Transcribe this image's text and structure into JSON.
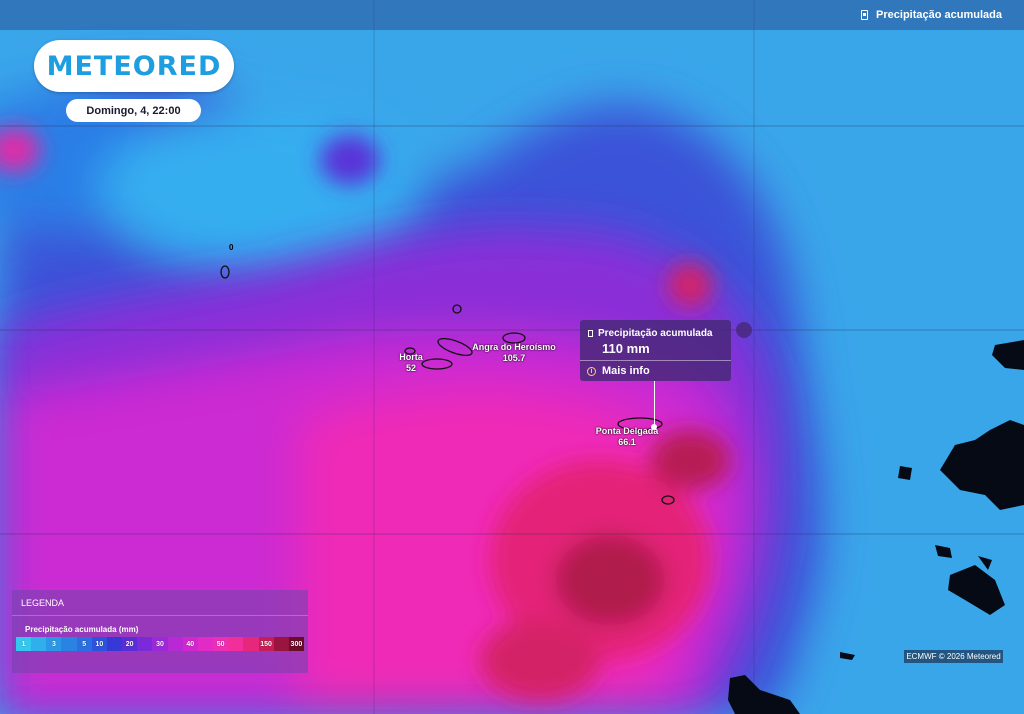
{
  "header": {
    "layer_title": "Precipitação acumulada",
    "layer_icon": "rain-gauge-icon"
  },
  "brand": {
    "logo_text": "METEORED",
    "logo_color": "#1d9ee0"
  },
  "timestamp": "Domingo, 4, 22:00",
  "map": {
    "stray_label": "0",
    "cities": [
      {
        "name": "Horta",
        "value": "52"
      },
      {
        "name": "Angra do Heroísmo",
        "value": "105.7"
      },
      {
        "name": "Ponta Delgada",
        "value": "66.1"
      }
    ]
  },
  "popup": {
    "title": "Precipitação acumulada",
    "value": "110 mm",
    "more_label": "Mais info",
    "icon": "info-icon"
  },
  "legend": {
    "title": "LEGENDA",
    "variable": "Precipitação acumulada (mm)",
    "steps": [
      {
        "label": "1",
        "color": "#32c8f0"
      },
      {
        "label": "",
        "color": "#2fb0ec"
      },
      {
        "label": "3",
        "color": "#2a98e6"
      },
      {
        "label": "",
        "color": "#2a82e2"
      },
      {
        "label": "5",
        "color": "#2a6ee0"
      },
      {
        "label": "10",
        "color": "#2d52dc"
      },
      {
        "label": "",
        "color": "#3838d6"
      },
      {
        "label": "20",
        "color": "#5a2ed6"
      },
      {
        "label": "",
        "color": "#7a2ad8"
      },
      {
        "label": "30",
        "color": "#9a2ad8"
      },
      {
        "label": "",
        "color": "#b828d4"
      },
      {
        "label": "40",
        "color": "#d226cf"
      },
      {
        "label": "",
        "color": "#e22ac6"
      },
      {
        "label": "50",
        "color": "#ee2eb6"
      },
      {
        "label": "",
        "color": "#f22e9a"
      },
      {
        "label": "",
        "color": "#e6287c"
      },
      {
        "label": "150",
        "color": "#c81e58"
      },
      {
        "label": "",
        "color": "#9a1440"
      },
      {
        "label": "300",
        "color": "#6a0c2a"
      }
    ]
  },
  "credit": "ECMWF © 2026 Meteored"
}
